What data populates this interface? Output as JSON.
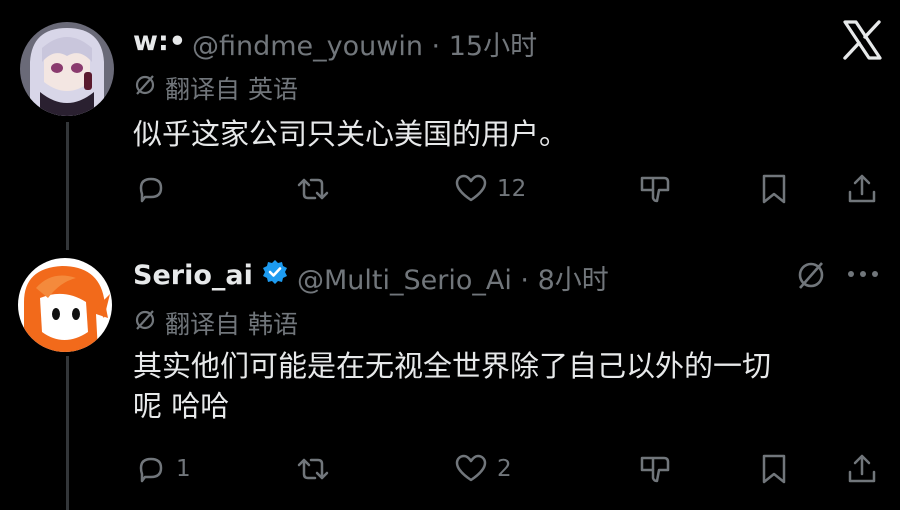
{
  "close_icon": "x-logo-icon",
  "tweets": [
    {
      "display_name": "w:•",
      "handle_time": "@findme_youwin · 15小时",
      "translated_label": "翻译自 英语",
      "text": "似乎这家公司只关心美国的用户。",
      "actions": {
        "reply": "",
        "retweet": "",
        "like": "12",
        "dislike": "",
        "bookmark": "",
        "share": ""
      }
    },
    {
      "display_name": "Serio_ai",
      "handle_time": "@Multi_Serio_Ai · 8小时",
      "translated_label": "翻译自 韩语",
      "text_line1": "其实他们可能是在无视全世界除了自己以外的一切",
      "text_line2": "呢 哈哈",
      "actions": {
        "reply": "1",
        "retweet": "",
        "like": "2",
        "dislike": "",
        "bookmark": "",
        "share": ""
      }
    }
  ],
  "colors": {
    "background": "#000000",
    "text": "#e7e9ea",
    "muted": "#71767b",
    "verified": "#1d9bf0"
  }
}
